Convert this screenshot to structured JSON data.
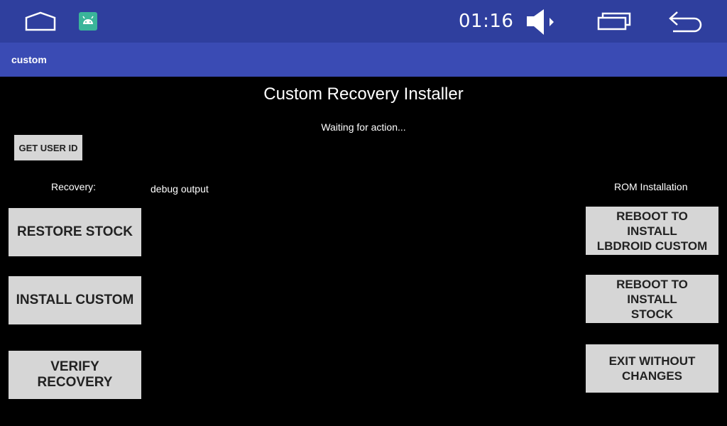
{
  "status_bar": {
    "time": "01:16",
    "icons": [
      "home-icon",
      "android-app-icon",
      "volume-icon",
      "recent-apps-icon",
      "back-icon"
    ],
    "background": "#2f3f9e"
  },
  "app_bar": {
    "title": "custom",
    "background": "#3a4bb4"
  },
  "main": {
    "title": "Custom Recovery Installer",
    "status": "Waiting for action...",
    "get_user_id_label": "GET USER ID",
    "recovery_label": "Recovery:",
    "debug_label": "debug output",
    "rom_label": "ROM Installation",
    "recovery_buttons": [
      "RESTORE STOCK",
      "INSTALL CUSTOM",
      "VERIFY RECOVERY"
    ],
    "rom_buttons": [
      "REBOOT TO INSTALL\nLBDROID CUSTOM",
      "REBOOT TO INSTALL\nSTOCK",
      "EXIT WITHOUT\nCHANGES"
    ]
  }
}
